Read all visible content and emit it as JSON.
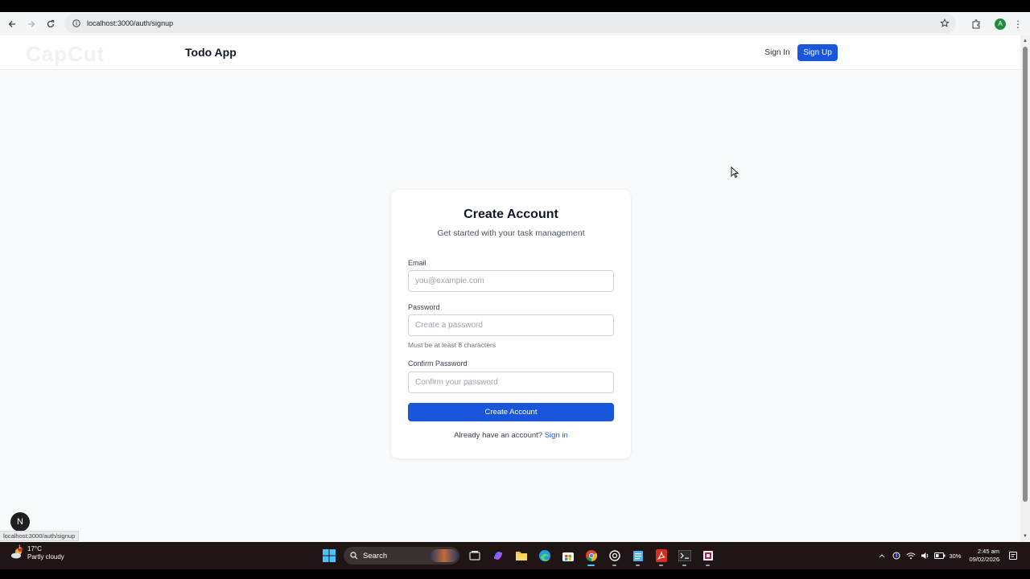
{
  "browser": {
    "url": "localhost:3000/auth/signup",
    "profile_initial": "A"
  },
  "watermark": "CapCut",
  "header": {
    "brand": "Todo App",
    "signin_label": "Sign In",
    "signup_label": "Sign Up"
  },
  "form": {
    "title": "Create Account",
    "subtitle": "Get started with your task management",
    "email_label": "Email",
    "email_placeholder": "you@example.com",
    "password_label": "Password",
    "password_placeholder": "Create a password",
    "password_hint": "Must be at least 8 characters",
    "confirm_label": "Confirm Password",
    "confirm_placeholder": "Confirm your password",
    "submit_label": "Create Account",
    "footer_text": "Already have an account? ",
    "footer_link": "Sign in"
  },
  "overlay": {
    "n_badge": "N",
    "status_url": "localhost:3000/auth/signup"
  },
  "taskbar": {
    "weather_temp": "17°C",
    "weather_desc": "Partly cloudy",
    "weather_badge": "1",
    "search_label": "Search",
    "battery": "30%",
    "time": "2:45 am",
    "date": "09/02/2026"
  },
  "colors": {
    "primary": "#1a56db",
    "page_bg": "#f9fafb",
    "taskbar_bg": "#1e1514"
  }
}
